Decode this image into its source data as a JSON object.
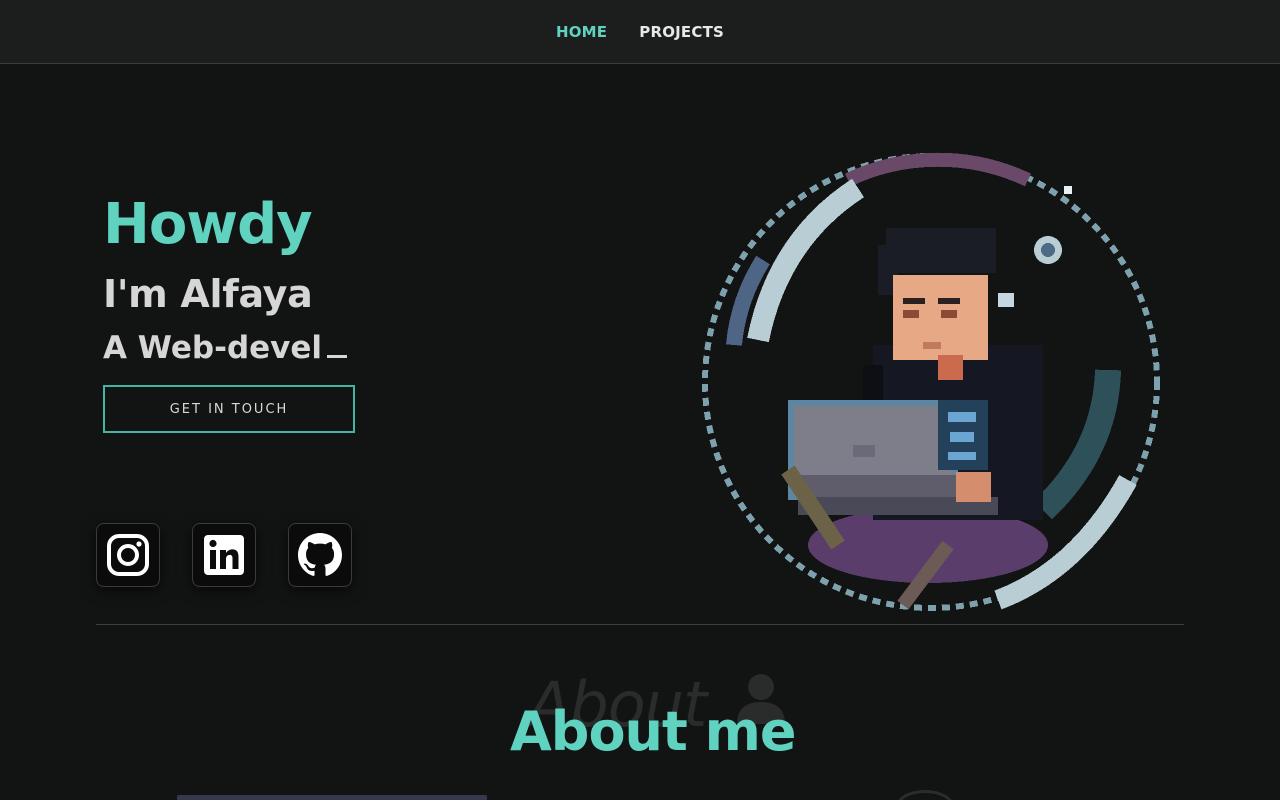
{
  "nav": {
    "items": [
      {
        "label": "HOME",
        "active": true
      },
      {
        "label": "PROJECTS",
        "active": false
      }
    ]
  },
  "hero": {
    "greeting": "Howdy",
    "intro": "I'm Alfaya",
    "role_typed": "A Web-devel",
    "cta_label": "GET IN TOUCH"
  },
  "social": [
    {
      "icon": "instagram-icon"
    },
    {
      "icon": "linkedin-icon"
    },
    {
      "icon": "github-icon"
    }
  ],
  "about": {
    "ghost_text": "About",
    "title": "About me"
  },
  "colors": {
    "accent": "#5fd3bf",
    "background": "#121313",
    "nav_bg": "#1c1d1d",
    "text": "#d6d6d6"
  }
}
